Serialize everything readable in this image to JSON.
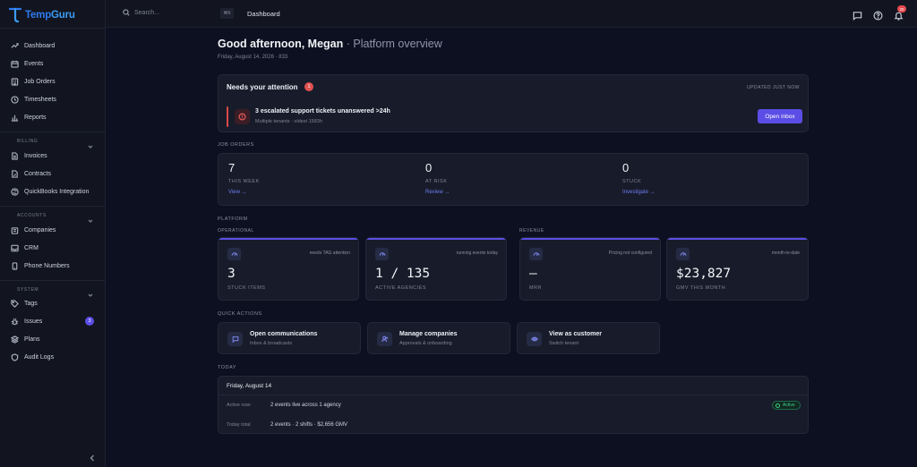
{
  "app": {
    "brand_part1": "Temp",
    "brand_part2": "Guru"
  },
  "sidebar": {
    "main_items": [
      {
        "label": "Dashboard",
        "icon": "trend-icon"
      },
      {
        "label": "Events",
        "icon": "calendar-icon"
      },
      {
        "label": "Job Orders",
        "icon": "building-icon"
      },
      {
        "label": "Timesheets",
        "icon": "clock-icon"
      },
      {
        "label": "Reports",
        "icon": "bar-chart-icon"
      }
    ],
    "billing": {
      "label": "BILLING",
      "items": [
        {
          "label": "Invoices",
          "icon": "file-icon"
        },
        {
          "label": "Contracts",
          "icon": "pen-file-icon"
        },
        {
          "label": "QuickBooks Integration",
          "icon": "sync-icon"
        }
      ]
    },
    "accounts": {
      "label": "ACCOUNTS",
      "items": [
        {
          "label": "Companies",
          "icon": "company-icon"
        },
        {
          "label": "CRM",
          "icon": "inbox-icon"
        },
        {
          "label": "Phone Numbers",
          "icon": "phone-icon"
        }
      ]
    },
    "system": {
      "label": "SYSTEM",
      "items": [
        {
          "label": "Tags",
          "icon": "tag-icon"
        },
        {
          "label": "Issues",
          "icon": "bug-icon",
          "badge": "3"
        },
        {
          "label": "Plans",
          "icon": "layers-icon"
        },
        {
          "label": "Audit Logs",
          "icon": "shield-icon"
        }
      ]
    }
  },
  "topbar": {
    "search_placeholder": "Search...",
    "shortcut": "⌘K",
    "breadcrumb": "Dashboard",
    "notification_count": "20"
  },
  "header": {
    "greeting": "Good afternoon, Megan",
    "subtitle": " · Platform overview",
    "date_line": "Friday, August 14, 2026 · 833"
  },
  "attention": {
    "title": "Needs your attention",
    "count": "1",
    "updated": "UPDATED JUST NOW",
    "item_title": "3 escalated support tickets unanswered >24h",
    "item_meta": "Multiple tenants · oldest 1583h",
    "button": "Open inbox"
  },
  "job_orders": {
    "label": "JOB ORDERS",
    "columns": [
      {
        "value": "7",
        "label": "THIS WEEK",
        "link": "View →"
      },
      {
        "value": "0",
        "label": "AT RISK",
        "link": "Review →"
      },
      {
        "value": "0",
        "label": "STUCK",
        "link": "Investigate →"
      }
    ]
  },
  "platform": {
    "label": "PLATFORM",
    "operational_label": "OPERATIONAL",
    "revenue_label": "REVENUE",
    "cards": [
      {
        "note": "needs TAG attention",
        "value": "3",
        "label": "STUCK ITEMS"
      },
      {
        "note": "running events today",
        "value": "1 / 135",
        "label": "ACTIVE AGENCIES"
      },
      {
        "note": "Pricing not configured",
        "value": "—",
        "label": "MRR"
      },
      {
        "note": "month-to-date",
        "value": "$23,827",
        "label": "GMV THIS MONTH"
      }
    ]
  },
  "quick_actions": {
    "label": "QUICK ACTIONS",
    "items": [
      {
        "title": "Open communications",
        "subtitle": "Inbox & broadcasts",
        "icon": "chat-icon"
      },
      {
        "title": "Manage companies",
        "subtitle": "Approvals & onboarding",
        "icon": "user-plus-icon"
      },
      {
        "title": "View as customer",
        "subtitle": "Switch tenant",
        "icon": "eye-icon"
      }
    ]
  },
  "today": {
    "label": "TODAY",
    "date": "Friday, August 14",
    "rows": [
      {
        "key": "Active now",
        "value": "2 events live across 1 agency"
      },
      {
        "key": "Today total",
        "value": "2 events · 2 shifts · $2,656 GMV"
      }
    ],
    "status": "Active"
  },
  "colors": {
    "accent": "#5b4ee6",
    "danger": "#e05252",
    "success": "#3fcf8e",
    "background": "#0d1020",
    "card": "#181c2a"
  }
}
